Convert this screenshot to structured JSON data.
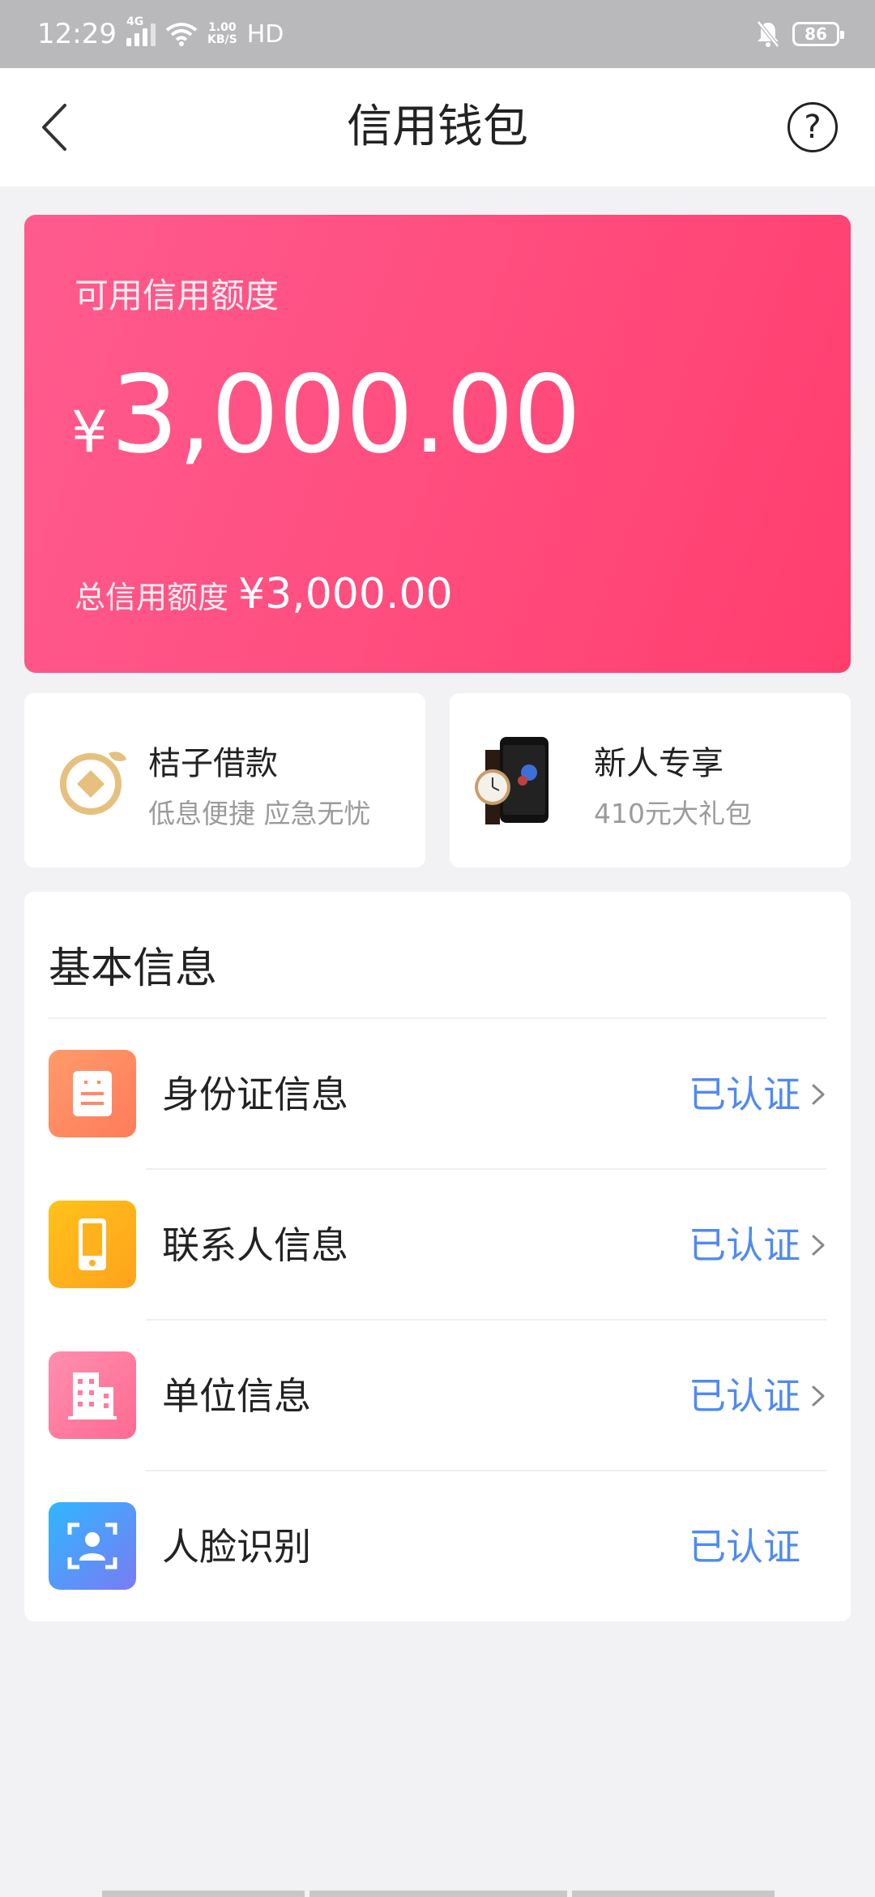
{
  "status_bar": {
    "time": "12:29",
    "network": "4G",
    "speed_value": "1.00",
    "speed_unit": "KB/S",
    "hd": "HD",
    "battery": "86"
  },
  "header": {
    "title": "信用钱包",
    "help_symbol": "?"
  },
  "credit_card": {
    "available_label": "可用信用额度",
    "currency": "¥",
    "available_amount": "3,000.00",
    "total_label": "总信用额度",
    "total_amount": "¥3,000.00",
    "gradient_colors": [
      "#ff5b8f",
      "#ff3e6e"
    ]
  },
  "promos": [
    {
      "title": "桔子借款",
      "subtitle": "低息便捷  应急无忧",
      "icon": "orange-coin-icon"
    },
    {
      "title": "新人专享",
      "subtitle": "410元大礼包",
      "icon": "watch-phone-image"
    }
  ],
  "basic_info": {
    "heading": "基本信息",
    "rows": [
      {
        "label": "身份证信息",
        "status": "已认证",
        "icon": "id-card-icon",
        "chevron": true
      },
      {
        "label": "联系人信息",
        "status": "已认证",
        "icon": "phone-icon",
        "chevron": true
      },
      {
        "label": "单位信息",
        "status": "已认证",
        "icon": "building-icon",
        "chevron": true
      },
      {
        "label": "人脸识别",
        "status": "已认证",
        "icon": "face-scan-icon",
        "chevron": false
      }
    ],
    "status_color": "#4f8af1"
  }
}
